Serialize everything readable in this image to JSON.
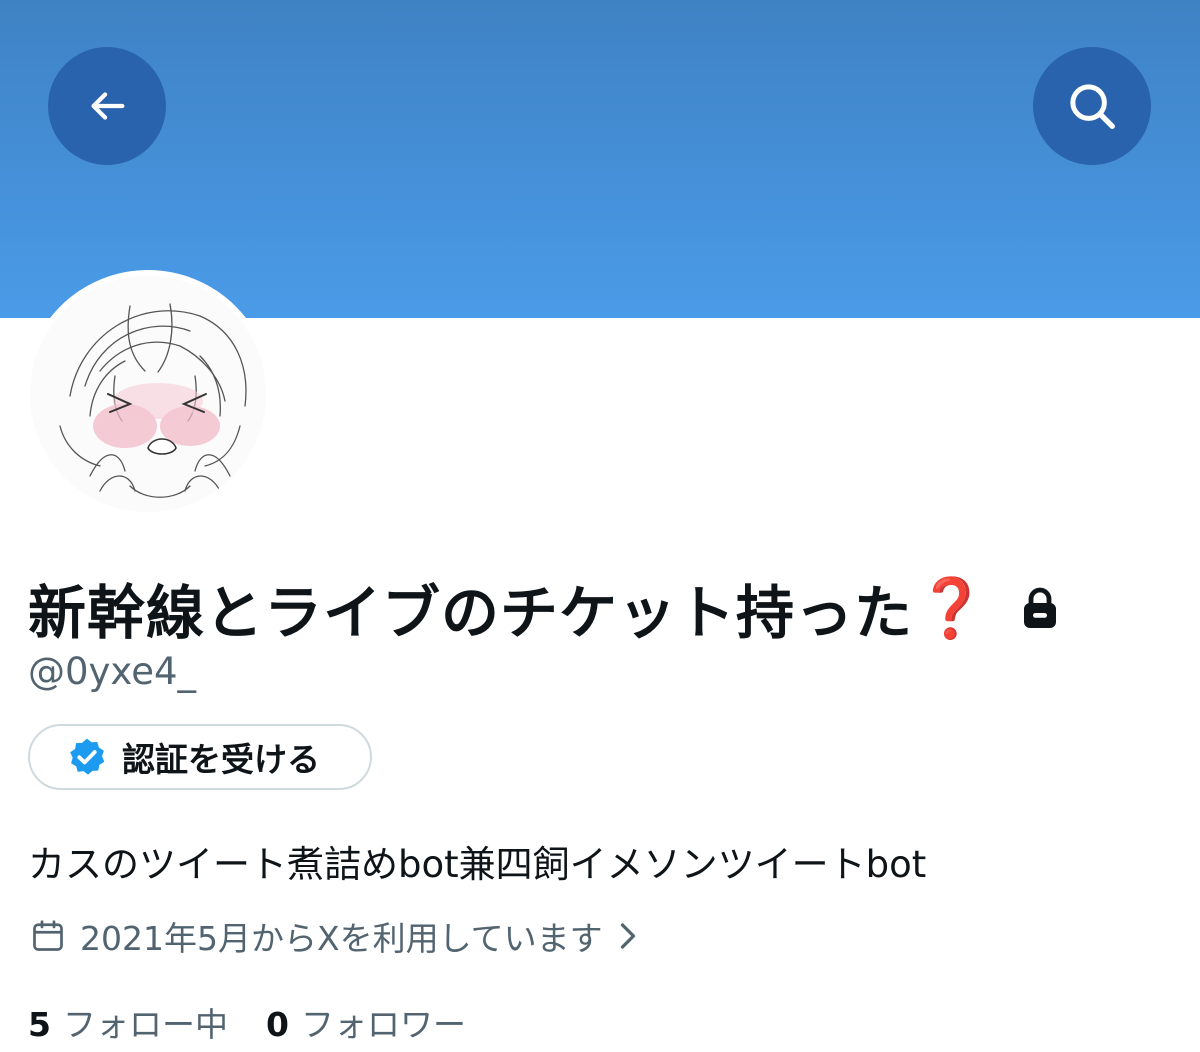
{
  "header": {
    "back_icon": "arrow-left-icon",
    "search_icon": "search-icon",
    "banner_color": "#4a9be8",
    "button_color": "#2a63ad"
  },
  "profile": {
    "display_name": "新幹線とライブのチケット持った",
    "name_emoji": "❓",
    "protected_icon": "lock-icon",
    "handle": "@0yxe4_",
    "verify_button_label": "認証を受ける",
    "verify_icon": "verified-badge-icon",
    "verify_color": "#1d9bf0",
    "bio": "カスのツイート煮詰めbot兼四飼イメソンツイートbot",
    "joined_text": "2021年5月からXを利用しています",
    "joined_icon": "calendar-icon",
    "following_count": "5",
    "following_label": "フォロー中",
    "followers_count": "0",
    "followers_label": "フォロワー"
  }
}
